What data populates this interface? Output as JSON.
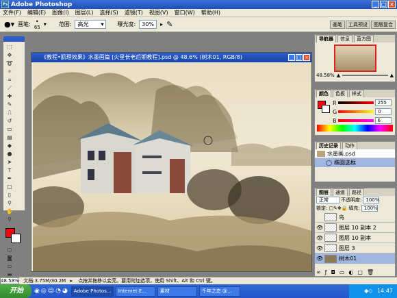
{
  "app": {
    "title": "Adobe Photoshop"
  },
  "menu": [
    "文件(F)",
    "编辑(E)",
    "图像(I)",
    "图层(L)",
    "选择(S)",
    "滤镜(T)",
    "视图(V)",
    "窗口(W)",
    "帮助(H)"
  ],
  "options": {
    "brush_label": "画笔:",
    "brush_size": "65",
    "range_label": "范围:",
    "range_value": "高光",
    "exposure_label": "曝光度:",
    "exposure_value": "30%"
  },
  "workspace_tabs": [
    "画笔",
    "工具预设",
    "图层复合"
  ],
  "document": {
    "title": "《教程•肌理效果》水墨画篇 [火星长老后期教程].psd @ 48.6% (树木01, RGB/8)"
  },
  "navigator": {
    "tabs": [
      "导航器",
      "信息",
      "直方图"
    ],
    "zoom": "48.58%"
  },
  "color_panel": {
    "tabs": [
      "颜色",
      "色板",
      "样式"
    ],
    "channels": [
      {
        "label": "R",
        "value": "255"
      },
      {
        "label": "G",
        "value": "0"
      },
      {
        "label": "B",
        "value": "6"
      }
    ],
    "foreground": "#ff0006",
    "background": "#ffffff"
  },
  "history": {
    "tabs": [
      "历史记录",
      "动作"
    ],
    "items": [
      "水墨画.psd",
      "椭圆选框"
    ]
  },
  "layers": {
    "tabs": [
      "图层",
      "通道",
      "路径"
    ],
    "blend_mode": "正常",
    "opacity_label": "不透明度:",
    "opacity_value": "100%",
    "lock_label": "锁定:",
    "fill_label": "填充:",
    "fill_value": "100%",
    "items": [
      {
        "name": "鸟"
      },
      {
        "name": "图层 10 副本 2"
      },
      {
        "name": "图层 10 副本"
      },
      {
        "name": "图层 3"
      },
      {
        "name": "树木01"
      }
    ]
  },
  "status": {
    "zoom": "48.58%",
    "doc_size": "文档:3.75M/30.2M",
    "hint": "点按并拖移以变亮。要用附加选项，使用 Shift、Alt 和 Ctrl 键。"
  },
  "taskbar": {
    "start": "开始",
    "tasks": [
      "Adobe Photos...",
      "Internet E...",
      "素材",
      "千年之恋 @..."
    ],
    "clock": "14:47"
  }
}
